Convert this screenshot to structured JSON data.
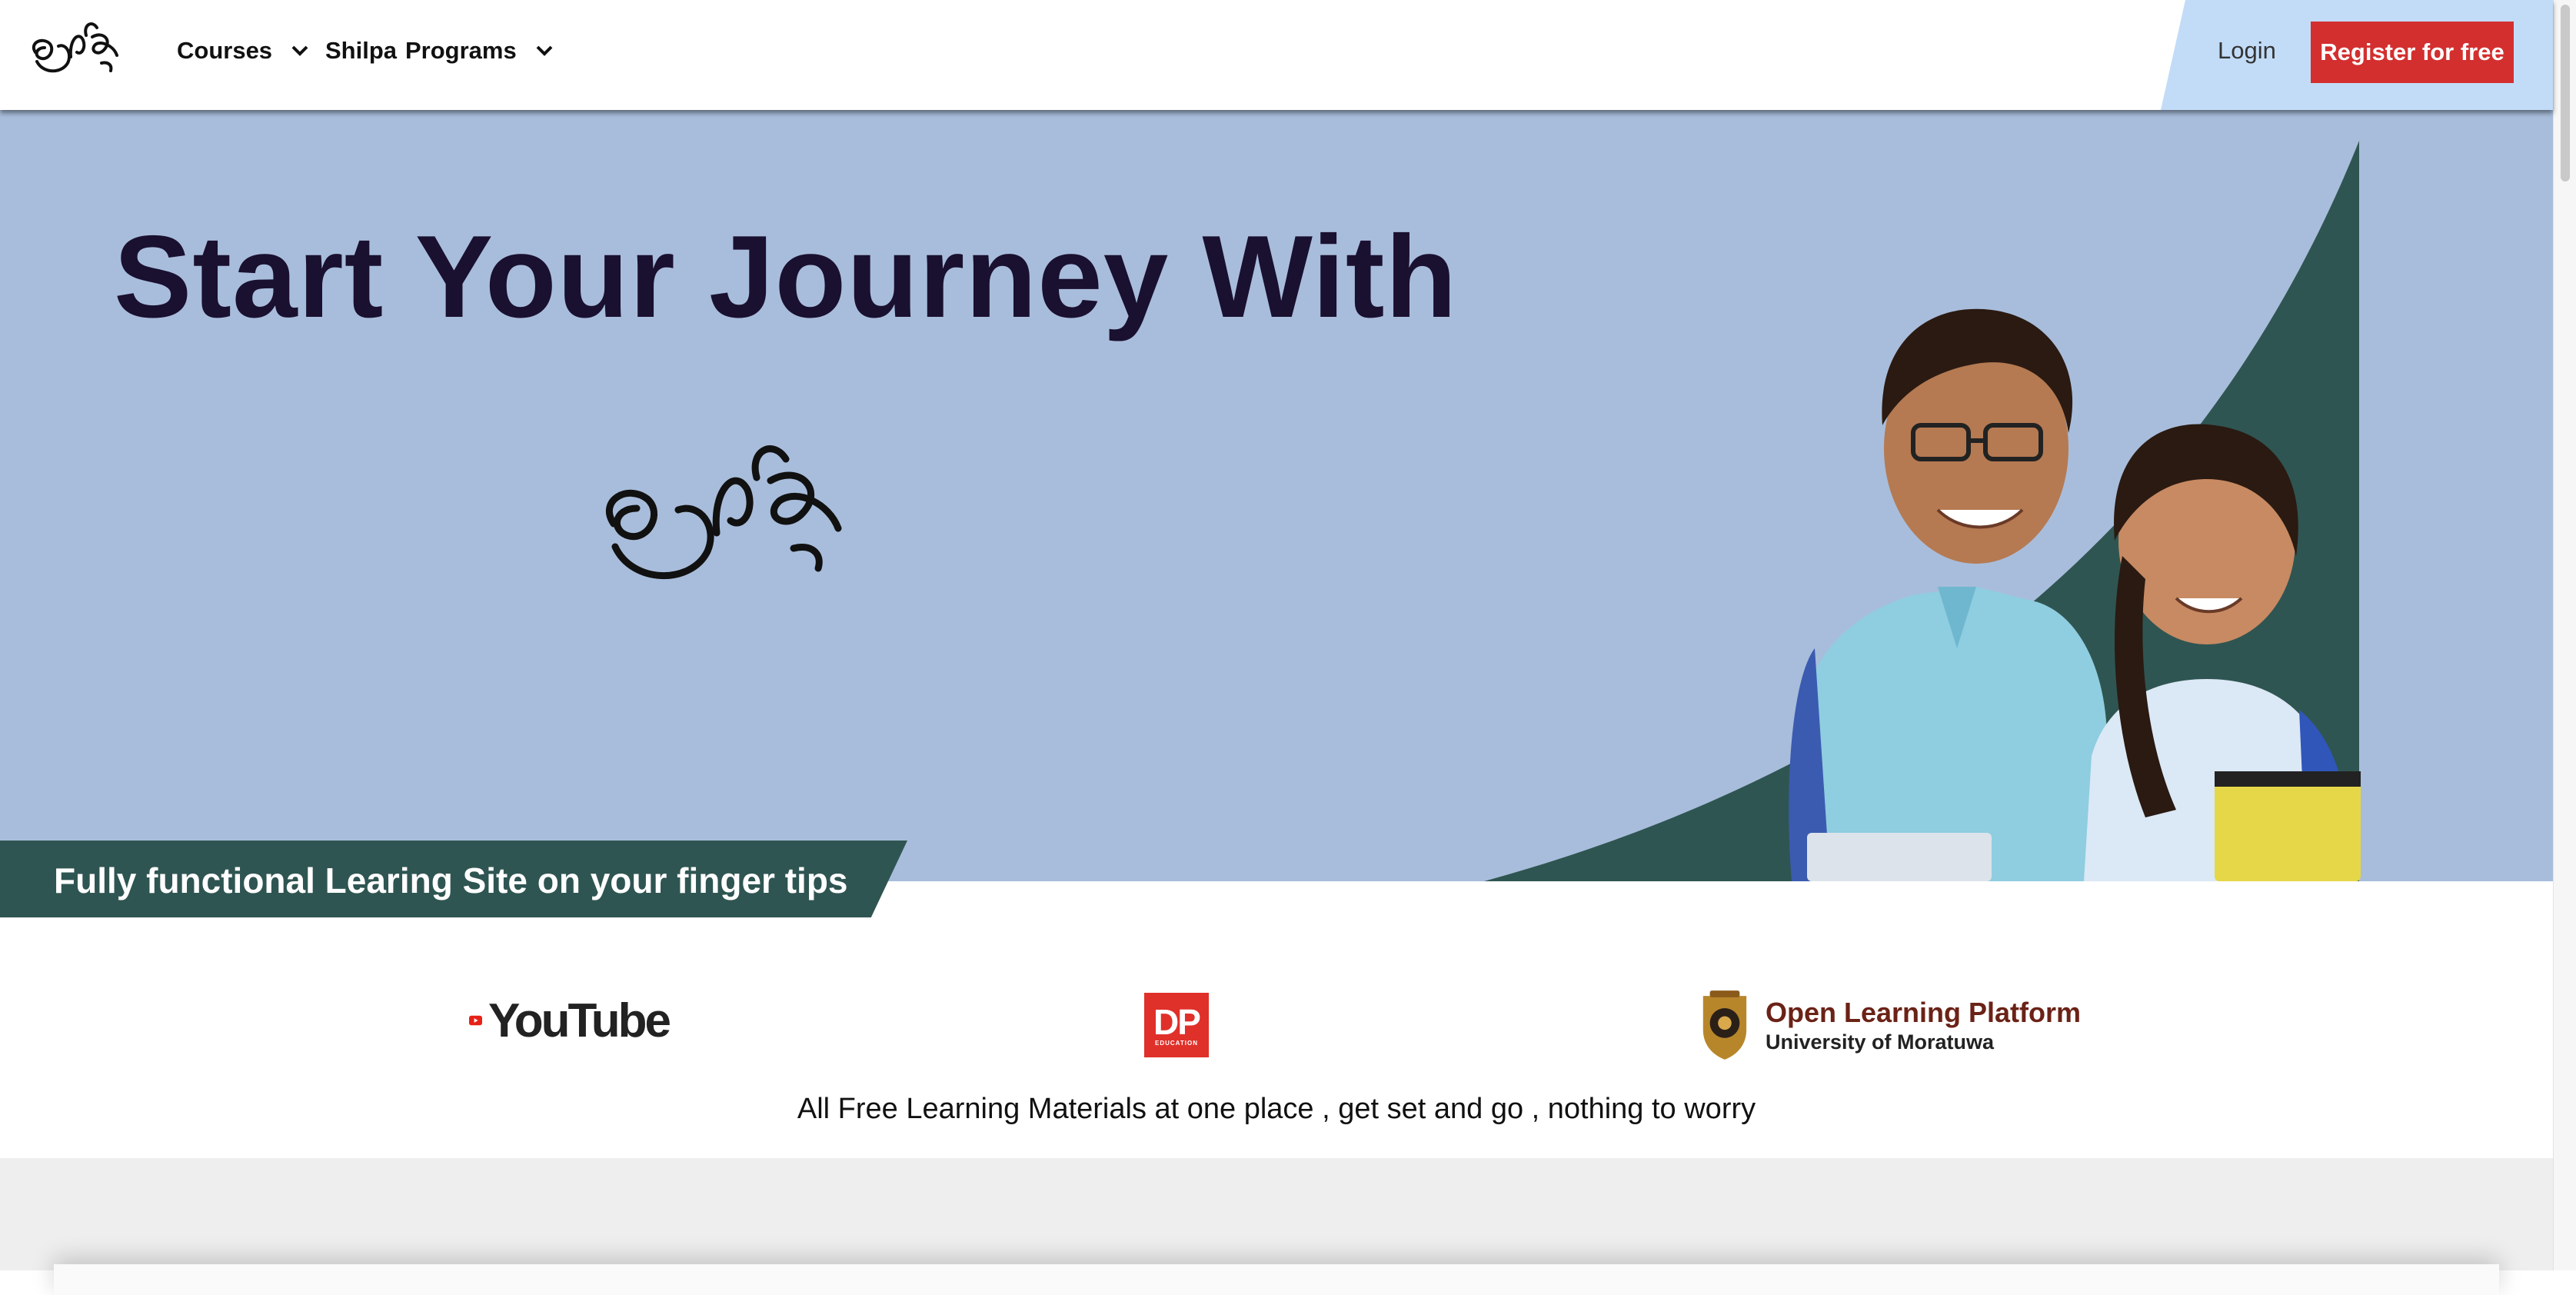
{
  "navbar": {
    "logo_icon": "shilpa-logo-icon",
    "items": [
      {
        "label": "Courses",
        "has_dropdown": true
      },
      {
        "label": "Shilpa",
        "has_dropdown": false
      },
      {
        "label": "Programs",
        "has_dropdown": true
      }
    ],
    "login_label": "Login",
    "register_label": "Register for free"
  },
  "hero": {
    "title": "Start Your Journey With",
    "logo_icon": "shilpa-logo-icon",
    "image": "students-photo",
    "tagline": "Fully functional Learing Site on your finger tips"
  },
  "partners": {
    "logos": [
      {
        "name": "youtube-logo",
        "text": "YouTube"
      },
      {
        "name": "dp-education-logo",
        "text": "DP",
        "subtext": "EDUCATION"
      },
      {
        "name": "open-learning-platform-logo",
        "title": "Open Learning Platform",
        "subtitle": "University of Moratuwa"
      }
    ],
    "caption": "All Free Learning Materials at one place , get set and go , nothing to worry"
  },
  "colors": {
    "hero_bg": "#a8bddb",
    "hero_title": "#1a1030",
    "accent_dark_teal": "#2f5552",
    "register_button": "#d32f2f",
    "auth_panel": "#c2dcf7"
  }
}
